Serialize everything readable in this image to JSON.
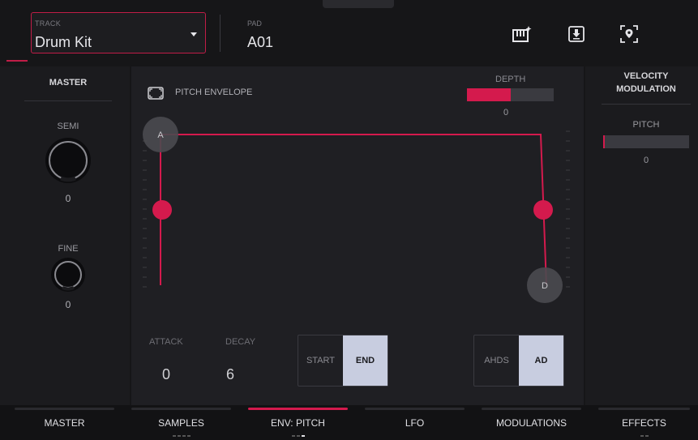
{
  "header": {
    "track_label": "TRACK",
    "track_value": "Drum Kit",
    "pad_label": "PAD",
    "pad_value": "A01",
    "icons": [
      "keyboard-sparkle-icon",
      "save-download-icon",
      "locate-icon"
    ]
  },
  "master": {
    "title": "MASTER",
    "semi_label": "SEMI",
    "semi_value": "0",
    "fine_label": "FINE",
    "fine_value": "0"
  },
  "envelope": {
    "title": "PITCH ENVELOPE",
    "depth_label": "DEPTH",
    "depth_value": "0",
    "depth_fill": 0.5,
    "point_a": "A",
    "point_d": "D",
    "attack_label": "ATTACK",
    "attack_value": "0",
    "decay_label": "DECAY",
    "decay_value": "6",
    "start_label": "START",
    "end_label": "END",
    "ahds_label": "AHDS",
    "ad_label": "AD",
    "selected_point": "END",
    "selected_mode": "AD"
  },
  "velocity": {
    "title_line1": "VELOCITY",
    "title_line2": "MODULATION",
    "pitch_label": "PITCH",
    "pitch_value": "0"
  },
  "tabs": [
    {
      "label": "MASTER",
      "active": false
    },
    {
      "label": "SAMPLES",
      "active": false
    },
    {
      "label": "ENV: PITCH",
      "active": true
    },
    {
      "label": "LFO",
      "active": false
    },
    {
      "label": "MODULATIONS",
      "active": false
    },
    {
      "label": "EFFECTS",
      "active": false
    }
  ],
  "colors": {
    "accent": "#d41a4d",
    "panel": "#1f1f23",
    "active_button": "#c8cde0"
  }
}
